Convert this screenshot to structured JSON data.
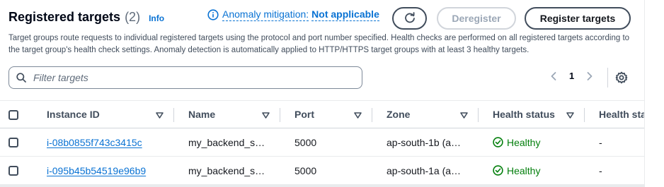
{
  "header": {
    "title": "Registered targets",
    "count": "(2)",
    "info_label": "Info"
  },
  "anomaly": {
    "label": "Anomaly mitigation:",
    "value": "Not applicable"
  },
  "buttons": {
    "deregister": "Deregister",
    "register": "Register targets"
  },
  "description": "Target groups route requests to individual registered targets using the protocol and port number specified. Health checks are performed on all registered targets according to the target group's health check settings. Anomaly detection is automatically applied to HTTP/HTTPS target groups with at least 3 healthy targets.",
  "filter": {
    "placeholder": "Filter targets",
    "value": ""
  },
  "pagination": {
    "current_page": "1"
  },
  "table": {
    "columns": [
      "Instance ID",
      "Name",
      "Port",
      "Zone",
      "Health status",
      "Health sta"
    ],
    "rows": [
      {
        "instance_id": "i-08b0855f743c3415c",
        "name": "my_backend_s…",
        "port": "5000",
        "zone": "ap-south-1b (a…",
        "health_status": "Healthy",
        "health_status_details": "-"
      },
      {
        "instance_id": "i-095b45b54519e96b9",
        "name": "my_backend_s…",
        "port": "5000",
        "zone": "ap-south-1a (a…",
        "health_status": "Healthy",
        "health_status_details": "-"
      }
    ]
  },
  "colors": {
    "link": "#0972d3",
    "healthy": "#037f0c",
    "text": "#16191f",
    "muted": "#5f6b7a"
  },
  "icons": [
    "info-icon",
    "refresh-icon",
    "search-icon",
    "chevron-left-icon",
    "chevron-right-icon",
    "settings-icon",
    "sort-icon",
    "check-circle-icon"
  ]
}
